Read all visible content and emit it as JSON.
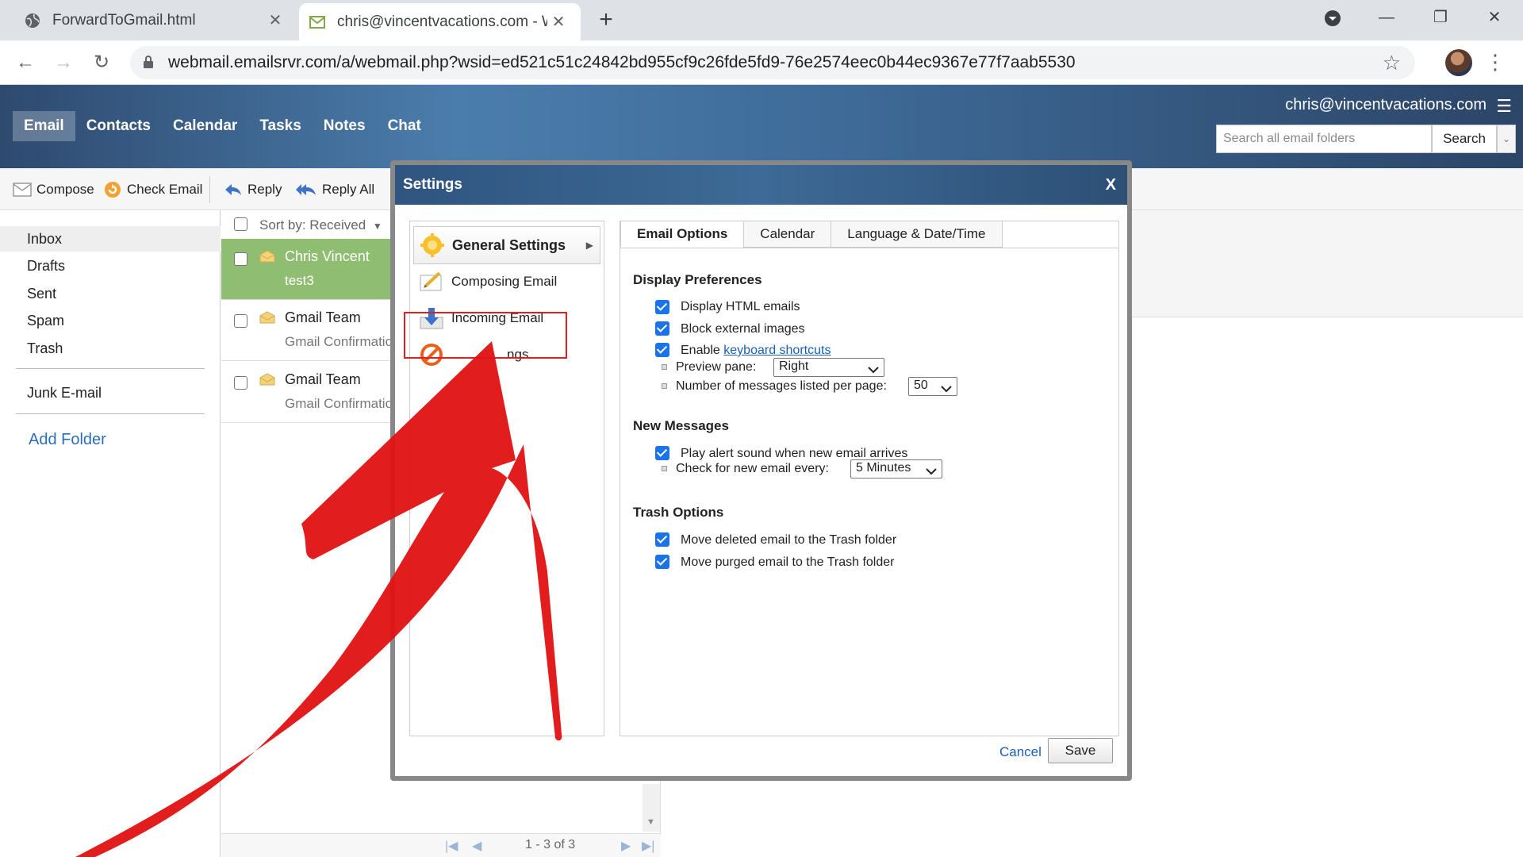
{
  "browser": {
    "tabs": [
      {
        "label": "ForwardToGmail.html",
        "icon": "globe-icon"
      },
      {
        "label": "chris@vincentvacations.com - W",
        "icon": "mail-icon"
      }
    ],
    "url": "webmail.emailsrvr.com/a/webmail.php?wsid=ed521c51c24842bd955cf9c26fde5fd9-76e2574eec0b44ec9367e77f7aab5530"
  },
  "header": {
    "nav": [
      "Email",
      "Contacts",
      "Calendar",
      "Tasks",
      "Notes",
      "Chat"
    ],
    "user_email": "chris@vincentvacations.com",
    "search_placeholder": "Search all email folders",
    "search_button": "Search"
  },
  "toolbar": {
    "compose": "Compose",
    "check_email": "Check Email",
    "reply": "Reply",
    "reply_all": "Reply All"
  },
  "folders": {
    "items": [
      "Inbox",
      "Drafts",
      "Sent",
      "Spam",
      "Trash"
    ],
    "junk": "Junk E-mail",
    "add_folder": "Add Folder"
  },
  "messages": {
    "sort_label": "Sort by: Received",
    "rows": [
      {
        "sender": "Chris Vincent",
        "subject": "test3"
      },
      {
        "sender": "Gmail Team",
        "subject": "Gmail Confirmatio"
      },
      {
        "sender": "Gmail Team",
        "subject": "Gmail Confirmatio"
      }
    ],
    "pager": "1 - 3 of 3"
  },
  "settings": {
    "title": "Settings",
    "close": "X",
    "sidebar": [
      {
        "label": "General Settings",
        "icon": "gear-icon"
      },
      {
        "label": "Composing Email",
        "icon": "compose-icon"
      },
      {
        "label": "Incoming Email",
        "icon": "download-arrow-icon"
      },
      {
        "label": "ngs",
        "icon": "block-icon"
      }
    ],
    "tabs": [
      "Email Options",
      "Calendar",
      "Language & Date/Time"
    ],
    "display": {
      "heading": "Display Preferences",
      "html": "Display HTML emails",
      "block": "Block external images",
      "enable": "Enable ",
      "shortcuts_link": "keyboard shortcuts",
      "preview_label": "Preview pane:",
      "preview_value": "Right",
      "per_page_label": "Number of messages listed per page:",
      "per_page_value": "50"
    },
    "new_messages": {
      "heading": "New Messages",
      "alert": "Play alert sound when new email arrives",
      "check_label": "Check for new email every:",
      "check_value": "5 Minutes"
    },
    "trash": {
      "heading": "Trash Options",
      "deleted": "Move deleted email to the Trash folder",
      "purged": "Move purged email to the Trash folder"
    },
    "cancel": "Cancel",
    "save": "Save"
  },
  "colors": {
    "header_blue": "#3e6b98",
    "selected_row": "#8fbe72",
    "checkbox": "#1a73e8",
    "annotation_red": "#e02020"
  }
}
